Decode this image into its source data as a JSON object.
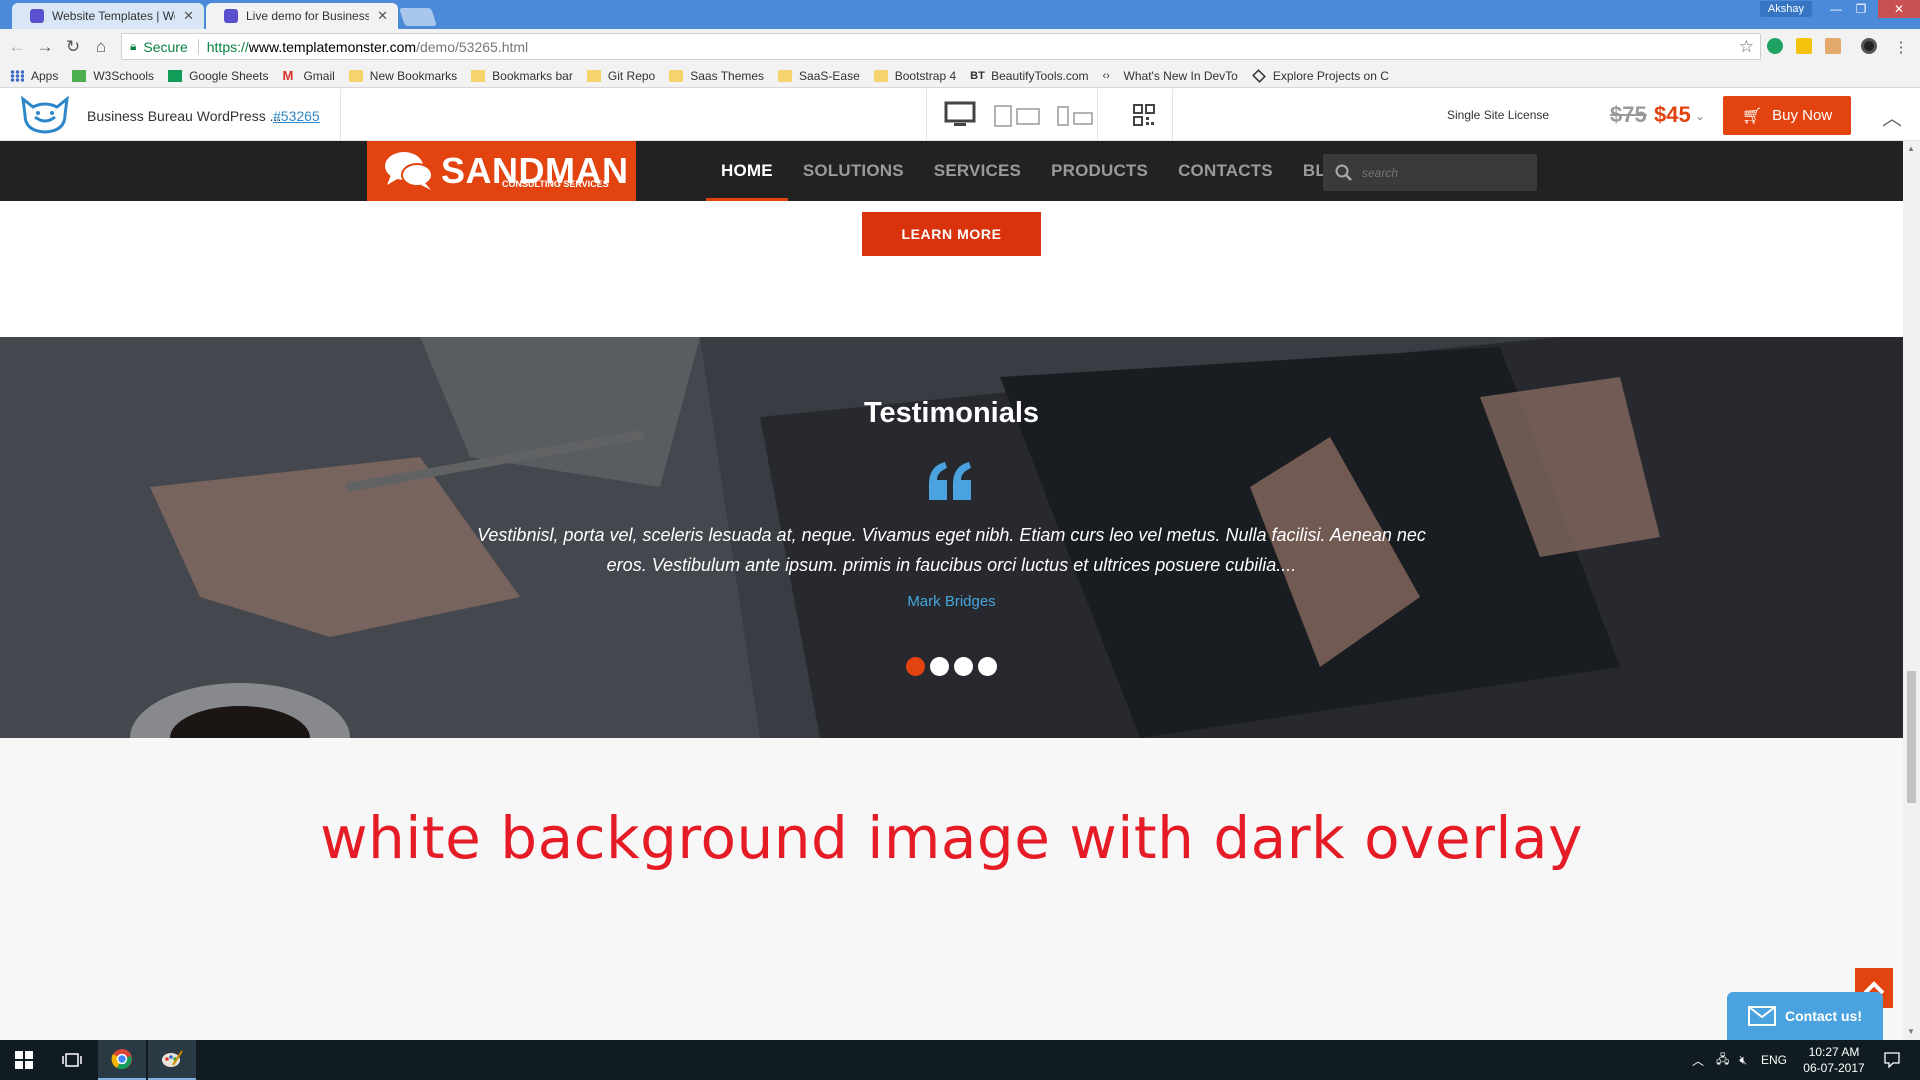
{
  "browser": {
    "tabs": [
      {
        "title": "Website Templates | Web",
        "active": false
      },
      {
        "title": "Live demo for Business B",
        "active": true
      }
    ],
    "user": "Akshay",
    "secure_label": "Secure",
    "url_scheme": "https://",
    "url_host": "www.templatemonster.com",
    "url_path": "/demo/53265.html",
    "bookmarks": [
      {
        "label": "Apps",
        "icon": "apps-grid-icon"
      },
      {
        "label": "W3Schools",
        "icon": "w3schools-icon"
      },
      {
        "label": "Google Sheets",
        "icon": "sheets-icon"
      },
      {
        "label": "Gmail",
        "icon": "gmail-icon"
      },
      {
        "label": "New Bookmarks",
        "icon": "folder-icon"
      },
      {
        "label": "Bookmarks bar",
        "icon": "folder-icon"
      },
      {
        "label": "Git Repo",
        "icon": "folder-icon"
      },
      {
        "label": "Saas Themes",
        "icon": "folder-icon"
      },
      {
        "label": "SaaS-Ease",
        "icon": "folder-icon"
      },
      {
        "label": "Bootstrap 4",
        "icon": "folder-icon"
      },
      {
        "label": "BeautifyTools.com",
        "icon": "beautify-icon"
      },
      {
        "label": "What's New In DevTo",
        "icon": "devtools-icon"
      },
      {
        "label": "Explore Projects on C",
        "icon": "codepen-icon"
      }
    ]
  },
  "demo_bar": {
    "template_name": "Business Bureau WordPress ...",
    "template_id": "#53265",
    "license": "Single Site License",
    "old_price": "$75",
    "new_price": "$45",
    "buy_label": "Buy Now"
  },
  "site": {
    "logo_text": "SANDMAN",
    "logo_tagline": "CONSULTING SERVICES",
    "menu": [
      {
        "label": "HOME",
        "active": true
      },
      {
        "label": "SOLUTIONS",
        "active": false
      },
      {
        "label": "SERVICES",
        "active": false
      },
      {
        "label": "PRODUCTS",
        "active": false
      },
      {
        "label": "CONTACTS",
        "active": false
      },
      {
        "label": "BLOG",
        "active": false
      }
    ],
    "search_placeholder": "search",
    "learn_more": "LEARN MORE",
    "testimonials": {
      "title": "Testimonials",
      "quote": "Vestibnisl, porta vel, sceleris lesuada at, neque. Vivamus eget nibh. Etiam curs leo vel metus. Nulla facilisi. Aenean nec eros. Vestibulum ante ipsum. primis in faucibus orci luctus et ultrices posuere cubilia....",
      "author": "Mark Bridges",
      "slides": 4,
      "active_slide": 1
    },
    "annotation": "white background image with dark overlay",
    "contact_label": "Contact us!"
  },
  "taskbar": {
    "language": "ENG",
    "time": "10:27 AM",
    "date": "06-07-2017"
  },
  "colors": {
    "accent": "#e2430f",
    "quote_blue": "#4aa3df",
    "annotation_red": "#e51c26",
    "nav_dark": "#222222"
  }
}
